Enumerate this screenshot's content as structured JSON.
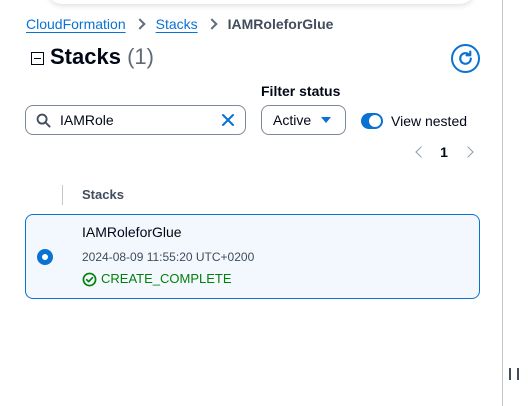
{
  "breadcrumb": {
    "items": [
      {
        "label": "CloudFormation"
      },
      {
        "label": "Stacks"
      },
      {
        "label": "IAMRoleforGlue"
      }
    ]
  },
  "header": {
    "title": "Stacks",
    "count": "(1)"
  },
  "filters": {
    "search": {
      "value": "IAMRole",
      "placeholder": ""
    },
    "status_label": "Filter status",
    "status_value": "Active",
    "view_nested_label": "View nested",
    "view_nested_on": true
  },
  "pagination": {
    "current_page": "1"
  },
  "table": {
    "column_header": "Stacks",
    "rows": [
      {
        "name": "IAMRoleforGlue",
        "created": "2024-08-09 11:55:20 UTC+0200",
        "status": "CREATE_COMPLETE",
        "selected": true
      }
    ]
  },
  "colors": {
    "accent": "#0972d3",
    "success": "#037f0c",
    "selected_bg": "#f2f8fd"
  },
  "icons": [
    "collapse-icon",
    "refresh-icon",
    "search-icon",
    "clear-icon",
    "caret-down-icon",
    "chevron-left-icon",
    "chevron-right-icon",
    "success-check-icon",
    "drag-handle-icon"
  ]
}
